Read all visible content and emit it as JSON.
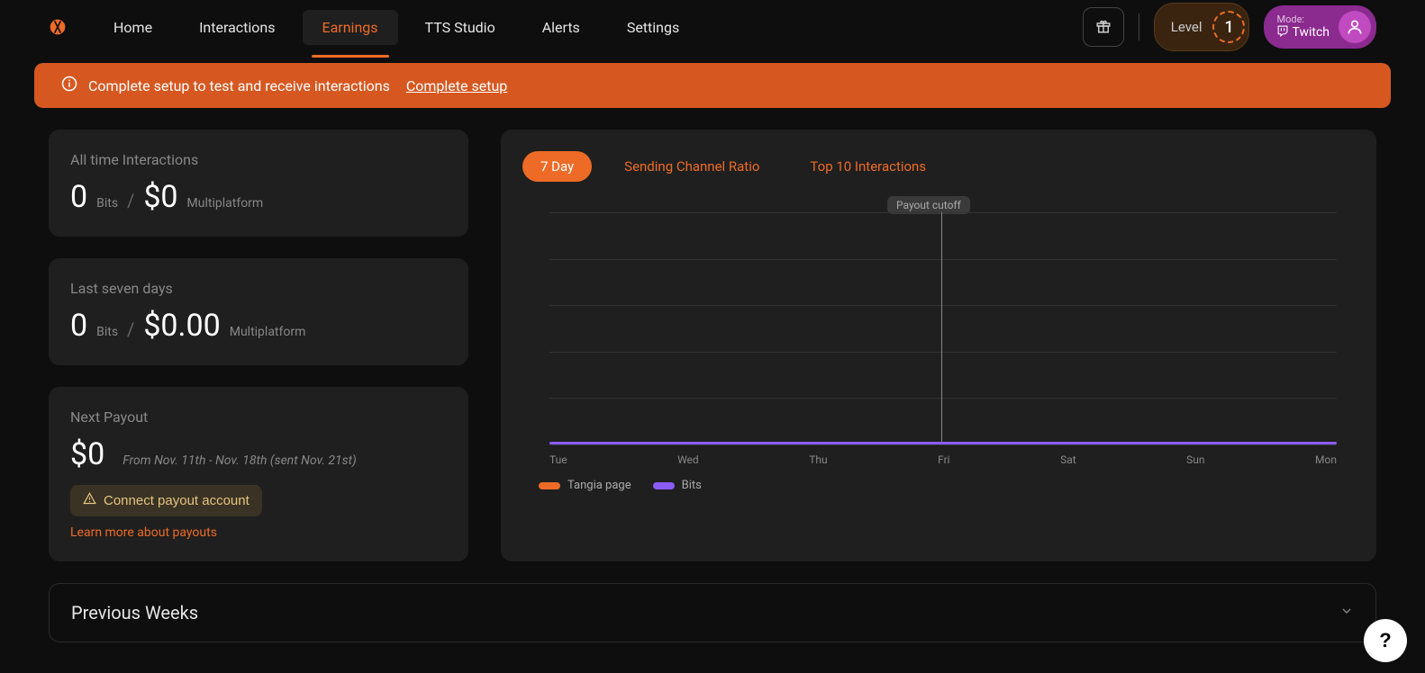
{
  "nav": {
    "items": [
      "Home",
      "Interactions",
      "Earnings",
      "TTS Studio",
      "Alerts",
      "Settings"
    ],
    "active_index": 2
  },
  "header": {
    "level_label": "Level",
    "level_value": "1",
    "mode_label": "Mode:",
    "mode_value": "Twitch"
  },
  "banner": {
    "text": "Complete setup to test and receive interactions",
    "link": "Complete setup"
  },
  "stats": {
    "all_time": {
      "label": "All time Interactions",
      "bits_value": "0",
      "bits_unit": "Bits",
      "money_value": "$0",
      "money_unit": "Multiplatform"
    },
    "last_seven": {
      "label": "Last seven days",
      "bits_value": "0",
      "bits_unit": "Bits",
      "money_value": "$0.00",
      "money_unit": "Multiplatform"
    },
    "payout": {
      "label": "Next Payout",
      "value": "$0",
      "range": "From Nov. 11th - Nov. 18th (sent Nov. 21st)",
      "connect_label": "Connect payout account",
      "learn_link": "Learn more about payouts"
    }
  },
  "chart_tabs": [
    "7 Day",
    "Sending Channel Ratio",
    "Top 10 Interactions"
  ],
  "chart_data": {
    "type": "line",
    "title": "",
    "categories": [
      "Tue",
      "Wed",
      "Thu",
      "Fri",
      "Sat",
      "Sun",
      "Mon"
    ],
    "series": [
      {
        "name": "Tangia page",
        "color": "#ed6b26",
        "values": [
          0,
          0,
          0,
          0,
          0,
          0,
          0
        ]
      },
      {
        "name": "Bits",
        "color": "#8b5cf6",
        "values": [
          0,
          0,
          0,
          0,
          0,
          0,
          0
        ]
      }
    ],
    "cutoff_label": "Payout cutoff",
    "cutoff_after_index": 3,
    "ylim": [
      0,
      1
    ],
    "grid_count": 6
  },
  "prev_weeks": {
    "title": "Previous Weeks"
  },
  "help": "?"
}
